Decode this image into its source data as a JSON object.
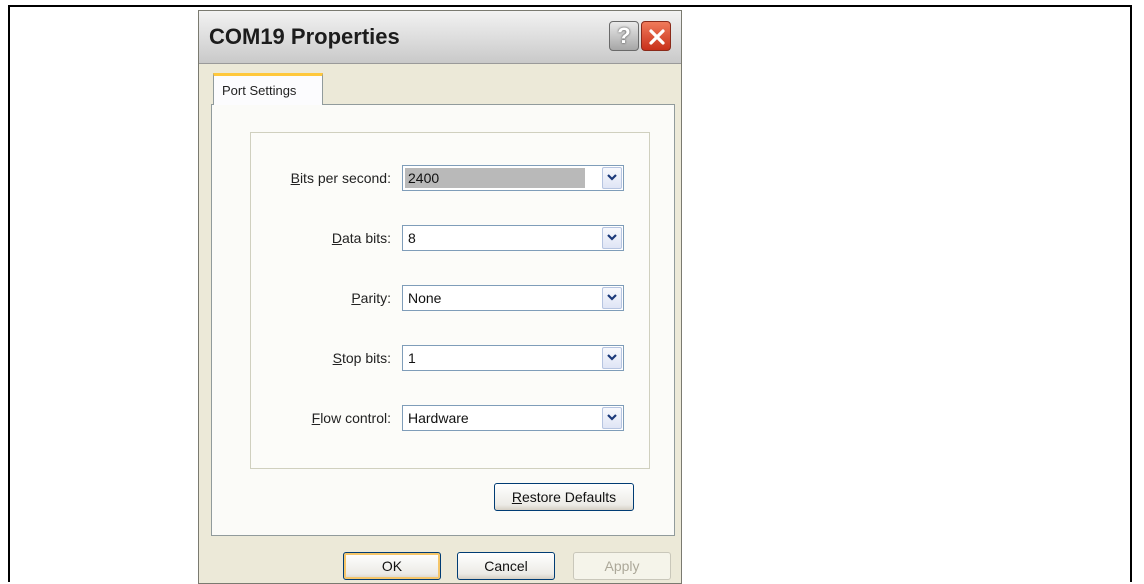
{
  "window": {
    "title": "COM19 Properties",
    "help_label": "?"
  },
  "tabs": [
    {
      "label": "Port Settings"
    }
  ],
  "fields": [
    {
      "label_first": "B",
      "label_rest": "its per second:",
      "value": "2400",
      "selected": true
    },
    {
      "label_first": "D",
      "label_rest": "ata bits:",
      "value": "8"
    },
    {
      "label_first": "P",
      "label_rest": "arity:",
      "value": "None"
    },
    {
      "label_first": "S",
      "label_rest": "top bits:",
      "value": "1"
    },
    {
      "label_first": "F",
      "label_rest": "low control:",
      "value": "Hardware"
    }
  ],
  "buttons": {
    "restore_first": "R",
    "restore_rest": "estore Defaults",
    "ok": "OK",
    "cancel": "Cancel",
    "apply": "Apply"
  }
}
